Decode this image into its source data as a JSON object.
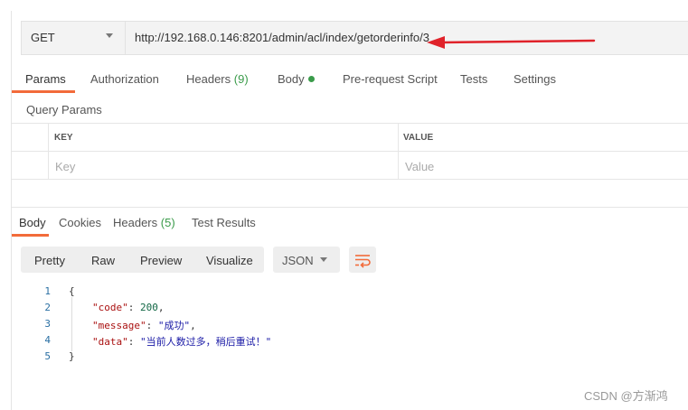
{
  "request": {
    "method": "GET",
    "url": "http://192.168.0.146:8201/admin/acl/index/getorderinfo/3"
  },
  "request_tabs": [
    {
      "label": "Params"
    },
    {
      "label": "Authorization"
    },
    {
      "label": "Headers",
      "count": "(9)"
    },
    {
      "label": "Body"
    },
    {
      "label": "Pre-request Script"
    },
    {
      "label": "Tests"
    },
    {
      "label": "Settings"
    }
  ],
  "query_params": {
    "title": "Query Params",
    "headers": [
      "KEY",
      "VALUE"
    ],
    "placeholders": [
      "Key",
      "Value"
    ]
  },
  "response_tabs": [
    {
      "label": "Body"
    },
    {
      "label": "Cookies"
    },
    {
      "label": "Headers",
      "count": "(5)"
    },
    {
      "label": "Test Results"
    }
  ],
  "view_modes": [
    "Pretty",
    "Raw",
    "Preview",
    "Visualize"
  ],
  "format": "JSON",
  "code": {
    "line_numbers": [
      "1",
      "2",
      "3",
      "4",
      "5"
    ],
    "open_brace": "{",
    "close_brace": "}",
    "entries": [
      {
        "key": "\"code\"",
        "sep": ": ",
        "value": "200",
        "end": ","
      },
      {
        "key": "\"message\"",
        "sep": ": ",
        "value": "\"成功\"",
        "end": ","
      },
      {
        "key": "\"data\"",
        "sep": ": ",
        "value": "\"当前人数过多，稍后重试！\"",
        "end": ""
      }
    ]
  },
  "watermark": "CSDN @方渐鸿",
  "colors": {
    "accent": "#f26b3a",
    "count_green": "#3a9b4a",
    "arrow_red": "#e0222a"
  }
}
